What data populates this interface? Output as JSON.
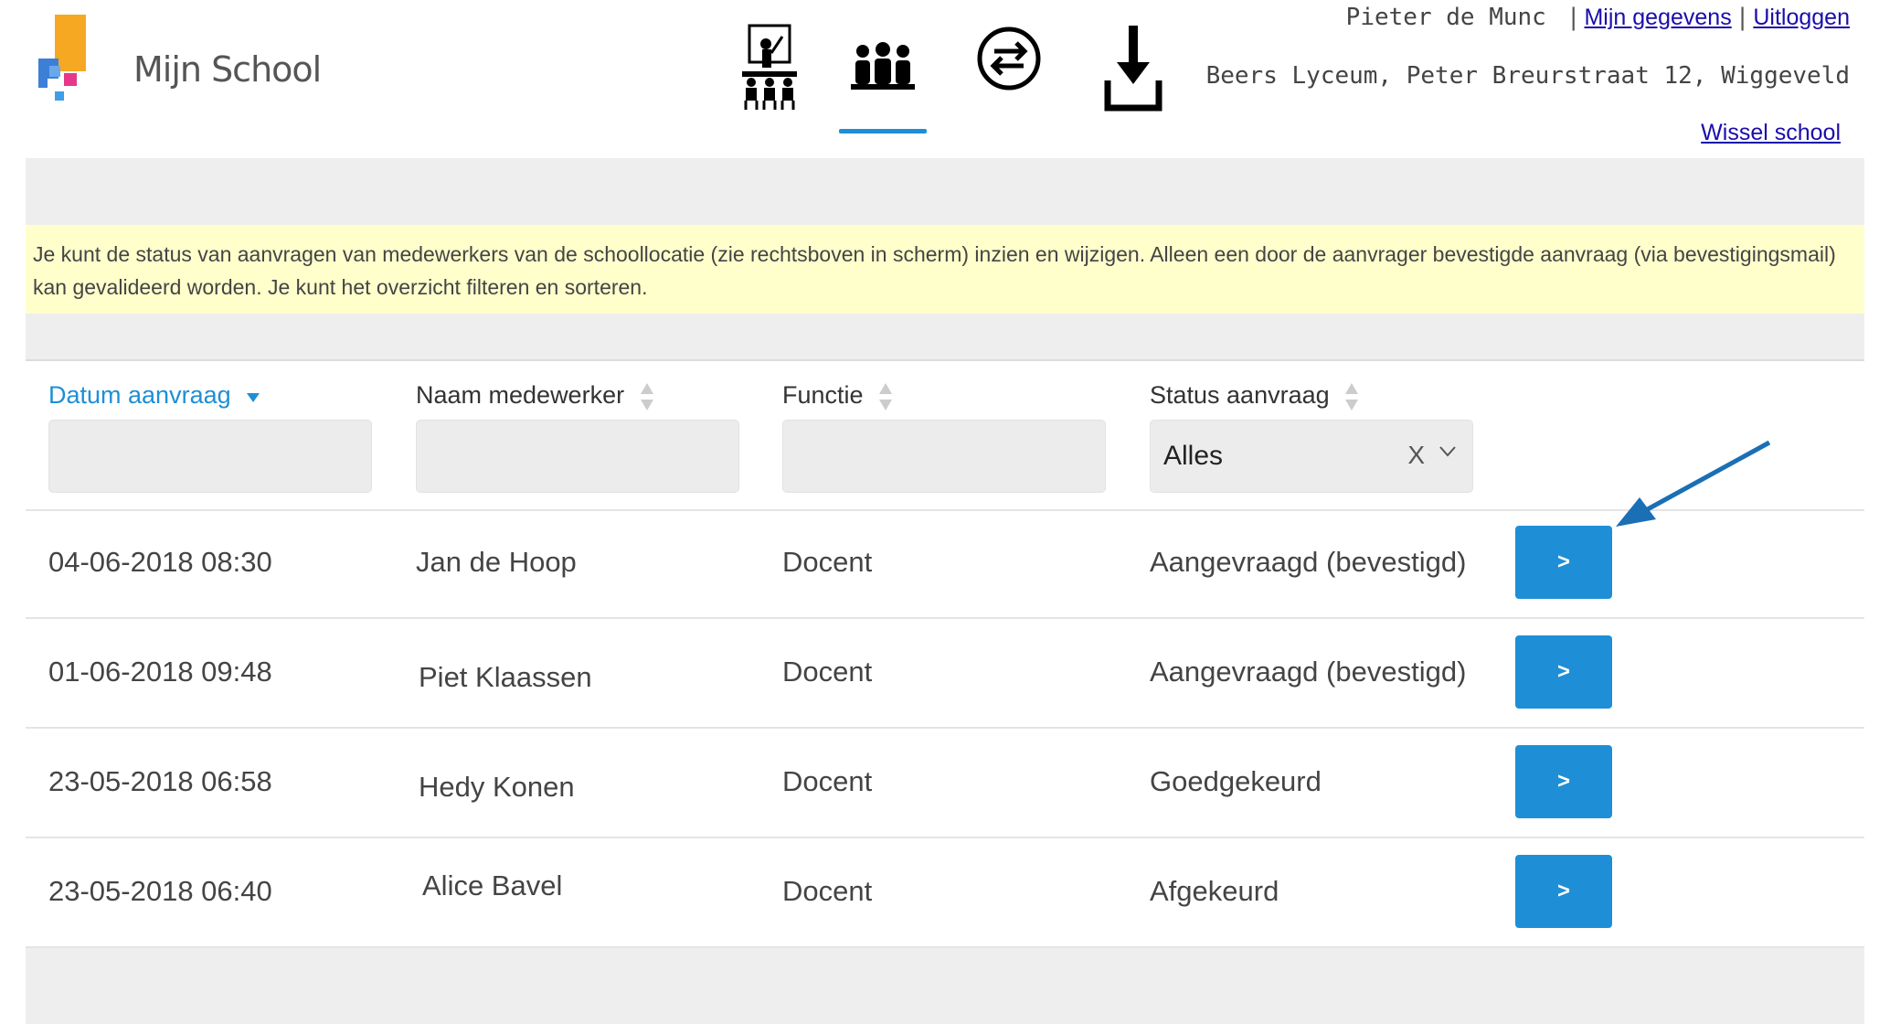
{
  "header": {
    "logo_text": "Mijn School",
    "nav": [
      {
        "icon": "classroom-icon",
        "active": false
      },
      {
        "icon": "staff-group-icon",
        "active": true
      },
      {
        "icon": "exchange-icon",
        "active": false
      },
      {
        "icon": "download-icon",
        "active": false
      }
    ],
    "user_name": "Pieter de Munc",
    "separator": "|",
    "my_details_link": "Mijn gegevens",
    "logout_link": "Uitloggen",
    "school_line": "Beers Lyceum, Peter Breurstraat 12, Wiggeveld",
    "switch_school_link": "Wissel school"
  },
  "notice": "Je kunt de status van aanvragen van medewerkers van de schoollocatie (zie rechtsboven in scherm) inzien en wijzigen. Alleen een door de aanvrager bevestigde aanvraag (via bevestigingsmail) kan gevalideerd worden. Je kunt het overzicht filteren en sorteren.",
  "table": {
    "columns": [
      "Datum aanvraag",
      "Naam medewerker",
      "Functie",
      "Status aanvraag"
    ],
    "status_filter": {
      "value": "Alles",
      "clear": "X"
    },
    "rows": [
      {
        "date": "04-06-2018 08:30",
        "name": "Jan de Hoop",
        "function": "Docent",
        "status": "Aangevraagd (bevestigd)",
        "action": ">"
      },
      {
        "date": "01-06-2018 09:48",
        "name": "Piet Klaassen",
        "function": "Docent",
        "status": "Aangevraagd (bevestigd)",
        "action": ">"
      },
      {
        "date": "23-05-2018 06:58",
        "name": "Hedy Konen",
        "function": "Docent",
        "status": "Goedgekeurd",
        "action": ">"
      },
      {
        "date": "23-05-2018 06:40",
        "name": "Alice Bavel",
        "function": "Docent",
        "status": "Afgekeurd",
        "action": ">"
      }
    ]
  },
  "colors": {
    "accent": "#1e8fd6",
    "notice_bg": "#ffffcc",
    "panel_bg": "#eeeeee",
    "link": "#1a0dab"
  }
}
